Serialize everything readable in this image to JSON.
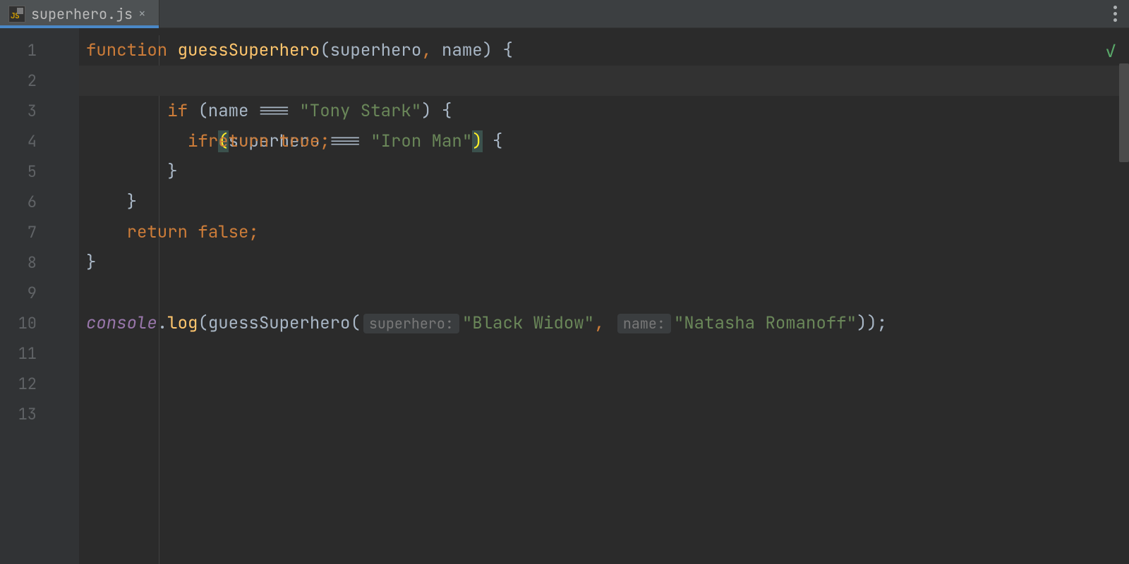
{
  "tab": {
    "filename": "superhero.js",
    "close_glyph": "×"
  },
  "status": {
    "check": "✓"
  },
  "lines": [
    "1",
    "2",
    "3",
    "4",
    "5",
    "6",
    "7",
    "8",
    "9",
    "10",
    "11",
    "12",
    "13"
  ],
  "code": {
    "l1": {
      "kw": "function",
      "sp": " ",
      "fn": "guessSuperhero",
      "open": "(",
      "p1": "superhero",
      "comma": ", ",
      "p2": "name",
      "close": ") {"
    },
    "l2": {
      "indent": "    ",
      "kw": "if ",
      "po": "(",
      "var": "superhero",
      "op": " === ",
      "str": "\"Iron Man\"",
      "pc": ")",
      "brace": " {"
    },
    "l3": {
      "indent": "        ",
      "kw": "if ",
      "rest": "(name === ",
      "str": "\"Tony Stark\"",
      "brace": ") {"
    },
    "l4": {
      "indent": "            ",
      "kw": "return ",
      "val": "true",
      "semi": ";"
    },
    "l5": {
      "indent": "        ",
      "brace": "}"
    },
    "l6": {
      "indent": "    ",
      "brace": "}"
    },
    "l7": {
      "indent": "    ",
      "kw": "return ",
      "val": "false",
      "semi": ";"
    },
    "l8": {
      "brace": "}"
    },
    "l10": {
      "obj": "console",
      "dot": ".",
      "fn": "log",
      "open": "(",
      "call": "guessSuperhero",
      "open2": "(",
      "hint1": "superhero:",
      "arg1": "\"Black Widow\"",
      "comma": ", ",
      "hint2": "name:",
      "arg2": "\"Natasha Romanoff\"",
      "close": "));"
    }
  }
}
